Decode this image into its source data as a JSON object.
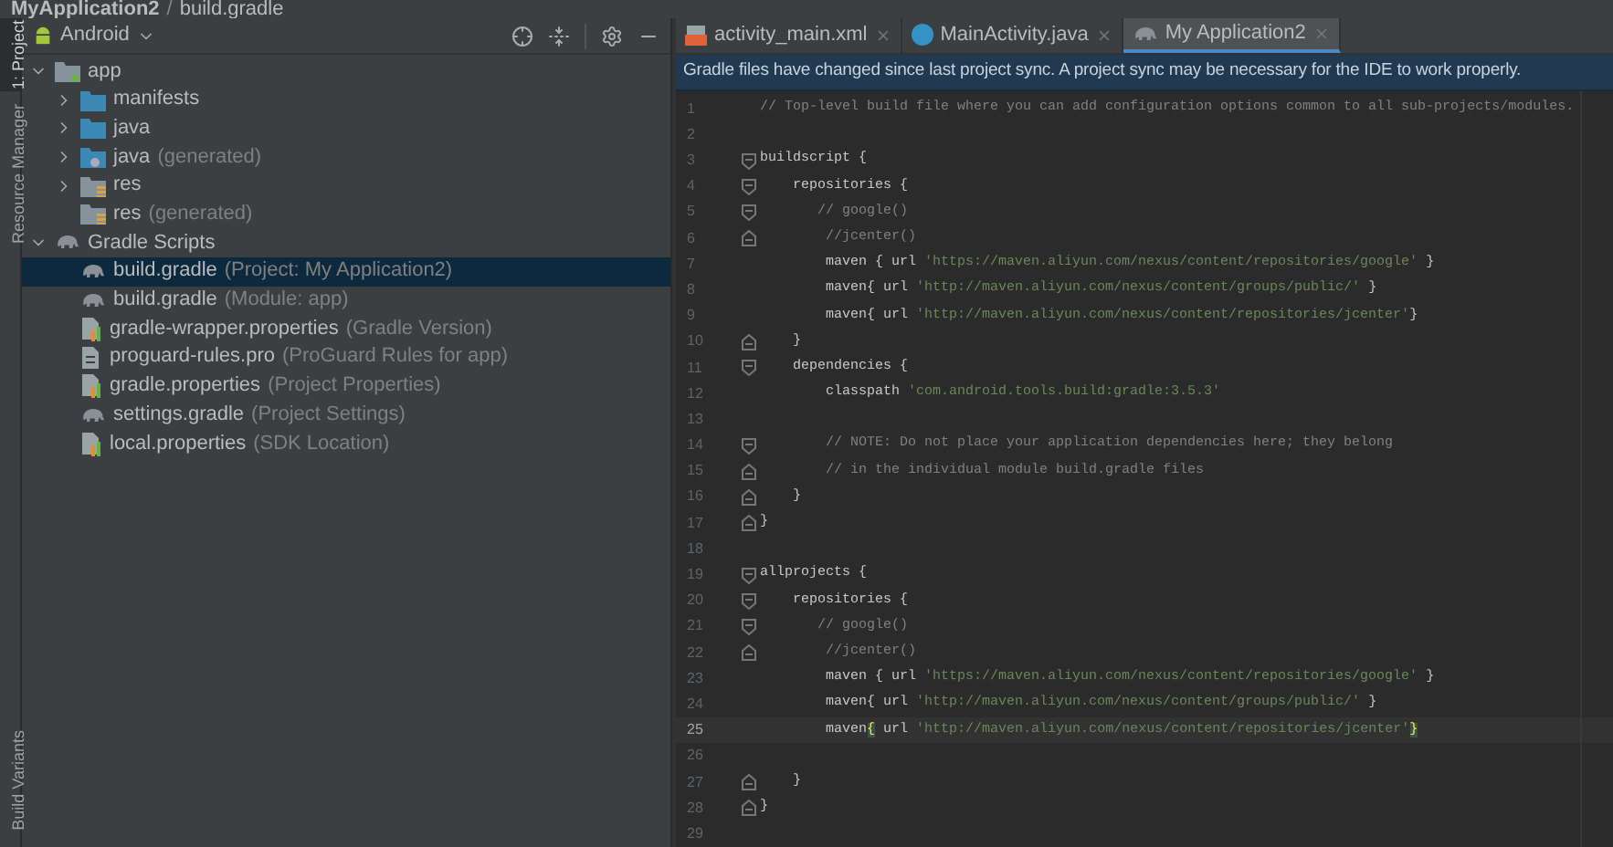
{
  "breadcrumb": {
    "project": "MyApplication2",
    "separator": "/",
    "file": "build.gradle"
  },
  "tool_strip": {
    "top": [
      {
        "label": "1: Project",
        "selected": true
      },
      {
        "label": "Resource Manager",
        "selected": false
      }
    ],
    "bottom": [
      {
        "label": "Build Variants",
        "selected": false
      }
    ]
  },
  "project_panel": {
    "view": "Android",
    "tree": [
      {
        "kind": "module",
        "name": "app",
        "expanded": true,
        "selected": false,
        "children": [
          {
            "kind": "folder",
            "name": "manifests",
            "expanded": false,
            "selected": false
          },
          {
            "kind": "folder",
            "name": "java",
            "expanded": false,
            "selected": false
          },
          {
            "kind": "folder-gen",
            "name": "java",
            "note": "(generated)",
            "expanded": false,
            "selected": false
          },
          {
            "kind": "res",
            "name": "res",
            "expanded": false,
            "selected": false
          },
          {
            "kind": "res",
            "name": "res",
            "note": "(generated)",
            "selected": false
          }
        ]
      },
      {
        "kind": "gradle",
        "name": "Gradle Scripts",
        "expanded": true,
        "selected": false,
        "children": [
          {
            "kind": "gradle",
            "name": "build.gradle",
            "note": "(Project: My Application2)",
            "selected": true
          },
          {
            "kind": "gradle",
            "name": "build.gradle",
            "note": "(Module: app)",
            "selected": false
          },
          {
            "kind": "properties",
            "name": "gradle-wrapper.properties",
            "note": "(Gradle Version)",
            "selected": false
          },
          {
            "kind": "file",
            "name": "proguard-rules.pro",
            "note": "(ProGuard Rules for app)",
            "selected": false
          },
          {
            "kind": "properties",
            "name": "gradle.properties",
            "note": "(Project Properties)",
            "selected": false
          },
          {
            "kind": "gradle",
            "name": "settings.gradle",
            "note": "(Project Settings)",
            "selected": false
          },
          {
            "kind": "properties",
            "name": "local.properties",
            "note": "(SDK Location)",
            "selected": false
          }
        ]
      }
    ]
  },
  "tabs": [
    {
      "kind": "xml",
      "label": "activity_main.xml",
      "selected": false
    },
    {
      "kind": "class",
      "label": "MainActivity.java",
      "selected": false
    },
    {
      "kind": "gradle",
      "label": "My Application2",
      "selected": true
    }
  ],
  "banner": "Gradle files have changed since last project sync. A project sync may be necessary for the IDE to work properly.",
  "code": [
    {
      "n": "1",
      "kind": "text",
      "current": false,
      "tokens": [
        {
          "kind": "comment",
          "text": "// Top-level build file where you can add configuration options common to all sub-projects/modules."
        }
      ]
    },
    {
      "n": "2",
      "kind": "text",
      "current": false
    },
    {
      "n": "3",
      "kind": "fold-start",
      "current": false,
      "tokens": [
        {
          "kind": "plain",
          "text": "buildscript {"
        }
      ]
    },
    {
      "n": "4",
      "kind": "fold-start",
      "current": false,
      "tokens": [
        {
          "kind": "plain",
          "text": "    repositories {"
        }
      ]
    },
    {
      "n": "5",
      "kind": "fold-start",
      "current": false,
      "tokens": [
        {
          "kind": "comment",
          "text": "       // google()"
        }
      ]
    },
    {
      "n": "6",
      "kind": "fold-end",
      "current": false,
      "tokens": [
        {
          "kind": "comment",
          "text": "        //jcenter()"
        }
      ]
    },
    {
      "n": "7",
      "kind": "text",
      "current": false,
      "tokens": [
        {
          "kind": "plain",
          "text": "        maven { url "
        },
        {
          "kind": "string",
          "text": "'https://maven.aliyun.com/nexus/content/repositories/google'"
        },
        {
          "kind": "plain",
          "text": " }"
        }
      ]
    },
    {
      "n": "8",
      "kind": "text",
      "current": false,
      "tokens": [
        {
          "kind": "plain",
          "text": "        maven{ url "
        },
        {
          "kind": "string",
          "text": "'http://maven.aliyun.com/nexus/content/groups/public/'"
        },
        {
          "kind": "plain",
          "text": " }"
        }
      ]
    },
    {
      "n": "9",
      "kind": "text",
      "current": false,
      "tokens": [
        {
          "kind": "plain",
          "text": "        maven{ url "
        },
        {
          "kind": "string",
          "text": "'http://maven.aliyun.com/nexus/content/repositories/jcenter'"
        },
        {
          "kind": "plain",
          "text": "}"
        }
      ]
    },
    {
      "n": "10",
      "kind": "fold-end",
      "current": false,
      "tokens": [
        {
          "kind": "plain",
          "text": "    }"
        }
      ]
    },
    {
      "n": "11",
      "kind": "fold-start",
      "current": false,
      "tokens": [
        {
          "kind": "plain",
          "text": "    dependencies {"
        }
      ]
    },
    {
      "n": "12",
      "kind": "text",
      "current": false,
      "tokens": [
        {
          "kind": "plain",
          "text": "        classpath "
        },
        {
          "kind": "string",
          "text": "'com.android.tools.build:gradle:3.5.3'"
        }
      ]
    },
    {
      "n": "13",
      "kind": "text",
      "current": false
    },
    {
      "n": "14",
      "kind": "fold-start",
      "current": false,
      "tokens": [
        {
          "kind": "comment",
          "text": "        // NOTE: Do not place your application dependencies here; they belong"
        }
      ]
    },
    {
      "n": "15",
      "kind": "fold-end",
      "current": false,
      "tokens": [
        {
          "kind": "comment",
          "text": "        // in the individual module build.gradle files"
        }
      ]
    },
    {
      "n": "16",
      "kind": "fold-end",
      "current": false,
      "tokens": [
        {
          "kind": "plain",
          "text": "    }"
        }
      ]
    },
    {
      "n": "17",
      "kind": "fold-end",
      "current": false,
      "tokens": [
        {
          "kind": "plain",
          "text": "}"
        }
      ]
    },
    {
      "n": "18",
      "kind": "text",
      "current": false
    },
    {
      "n": "19",
      "kind": "fold-start",
      "current": false,
      "tokens": [
        {
          "kind": "plain",
          "text": "allprojects {"
        }
      ]
    },
    {
      "n": "20",
      "kind": "fold-start",
      "current": false,
      "tokens": [
        {
          "kind": "plain",
          "text": "    repositories {"
        }
      ]
    },
    {
      "n": "21",
      "kind": "fold-start",
      "current": false,
      "tokens": [
        {
          "kind": "comment",
          "text": "       // google()"
        }
      ]
    },
    {
      "n": "22",
      "kind": "fold-end",
      "current": false,
      "tokens": [
        {
          "kind": "comment",
          "text": "        //jcenter()"
        }
      ]
    },
    {
      "n": "23",
      "kind": "text",
      "current": false,
      "tokens": [
        {
          "kind": "plain",
          "text": "        maven { url "
        },
        {
          "kind": "string",
          "text": "'https://maven.aliyun.com/nexus/content/repositories/google'"
        },
        {
          "kind": "plain",
          "text": " }"
        }
      ]
    },
    {
      "n": "24",
      "kind": "text",
      "current": false,
      "tokens": [
        {
          "kind": "plain",
          "text": "        maven{ url "
        },
        {
          "kind": "string",
          "text": "'http://maven.aliyun.com/nexus/content/groups/public/'"
        },
        {
          "kind": "plain",
          "text": " }"
        }
      ]
    },
    {
      "n": "25",
      "kind": "text",
      "current": true,
      "tokens": [
        {
          "kind": "plain",
          "text": "        maven"
        },
        {
          "kind": "brace-match",
          "text": "{"
        },
        {
          "kind": "plain",
          "text": " url "
        },
        {
          "kind": "string",
          "text": "'http://maven.aliyun.com/nexus/content/repositories/jcenter'"
        },
        {
          "kind": "brace-match",
          "text": "}"
        }
      ]
    },
    {
      "n": "26",
      "kind": "text",
      "current": false
    },
    {
      "n": "27",
      "kind": "fold-end",
      "current": false,
      "tokens": [
        {
          "kind": "plain",
          "text": "    }"
        }
      ]
    },
    {
      "n": "28",
      "kind": "fold-end",
      "current": false,
      "tokens": [
        {
          "kind": "plain",
          "text": "}"
        }
      ]
    },
    {
      "n": "29",
      "kind": "text",
      "current": false
    }
  ]
}
